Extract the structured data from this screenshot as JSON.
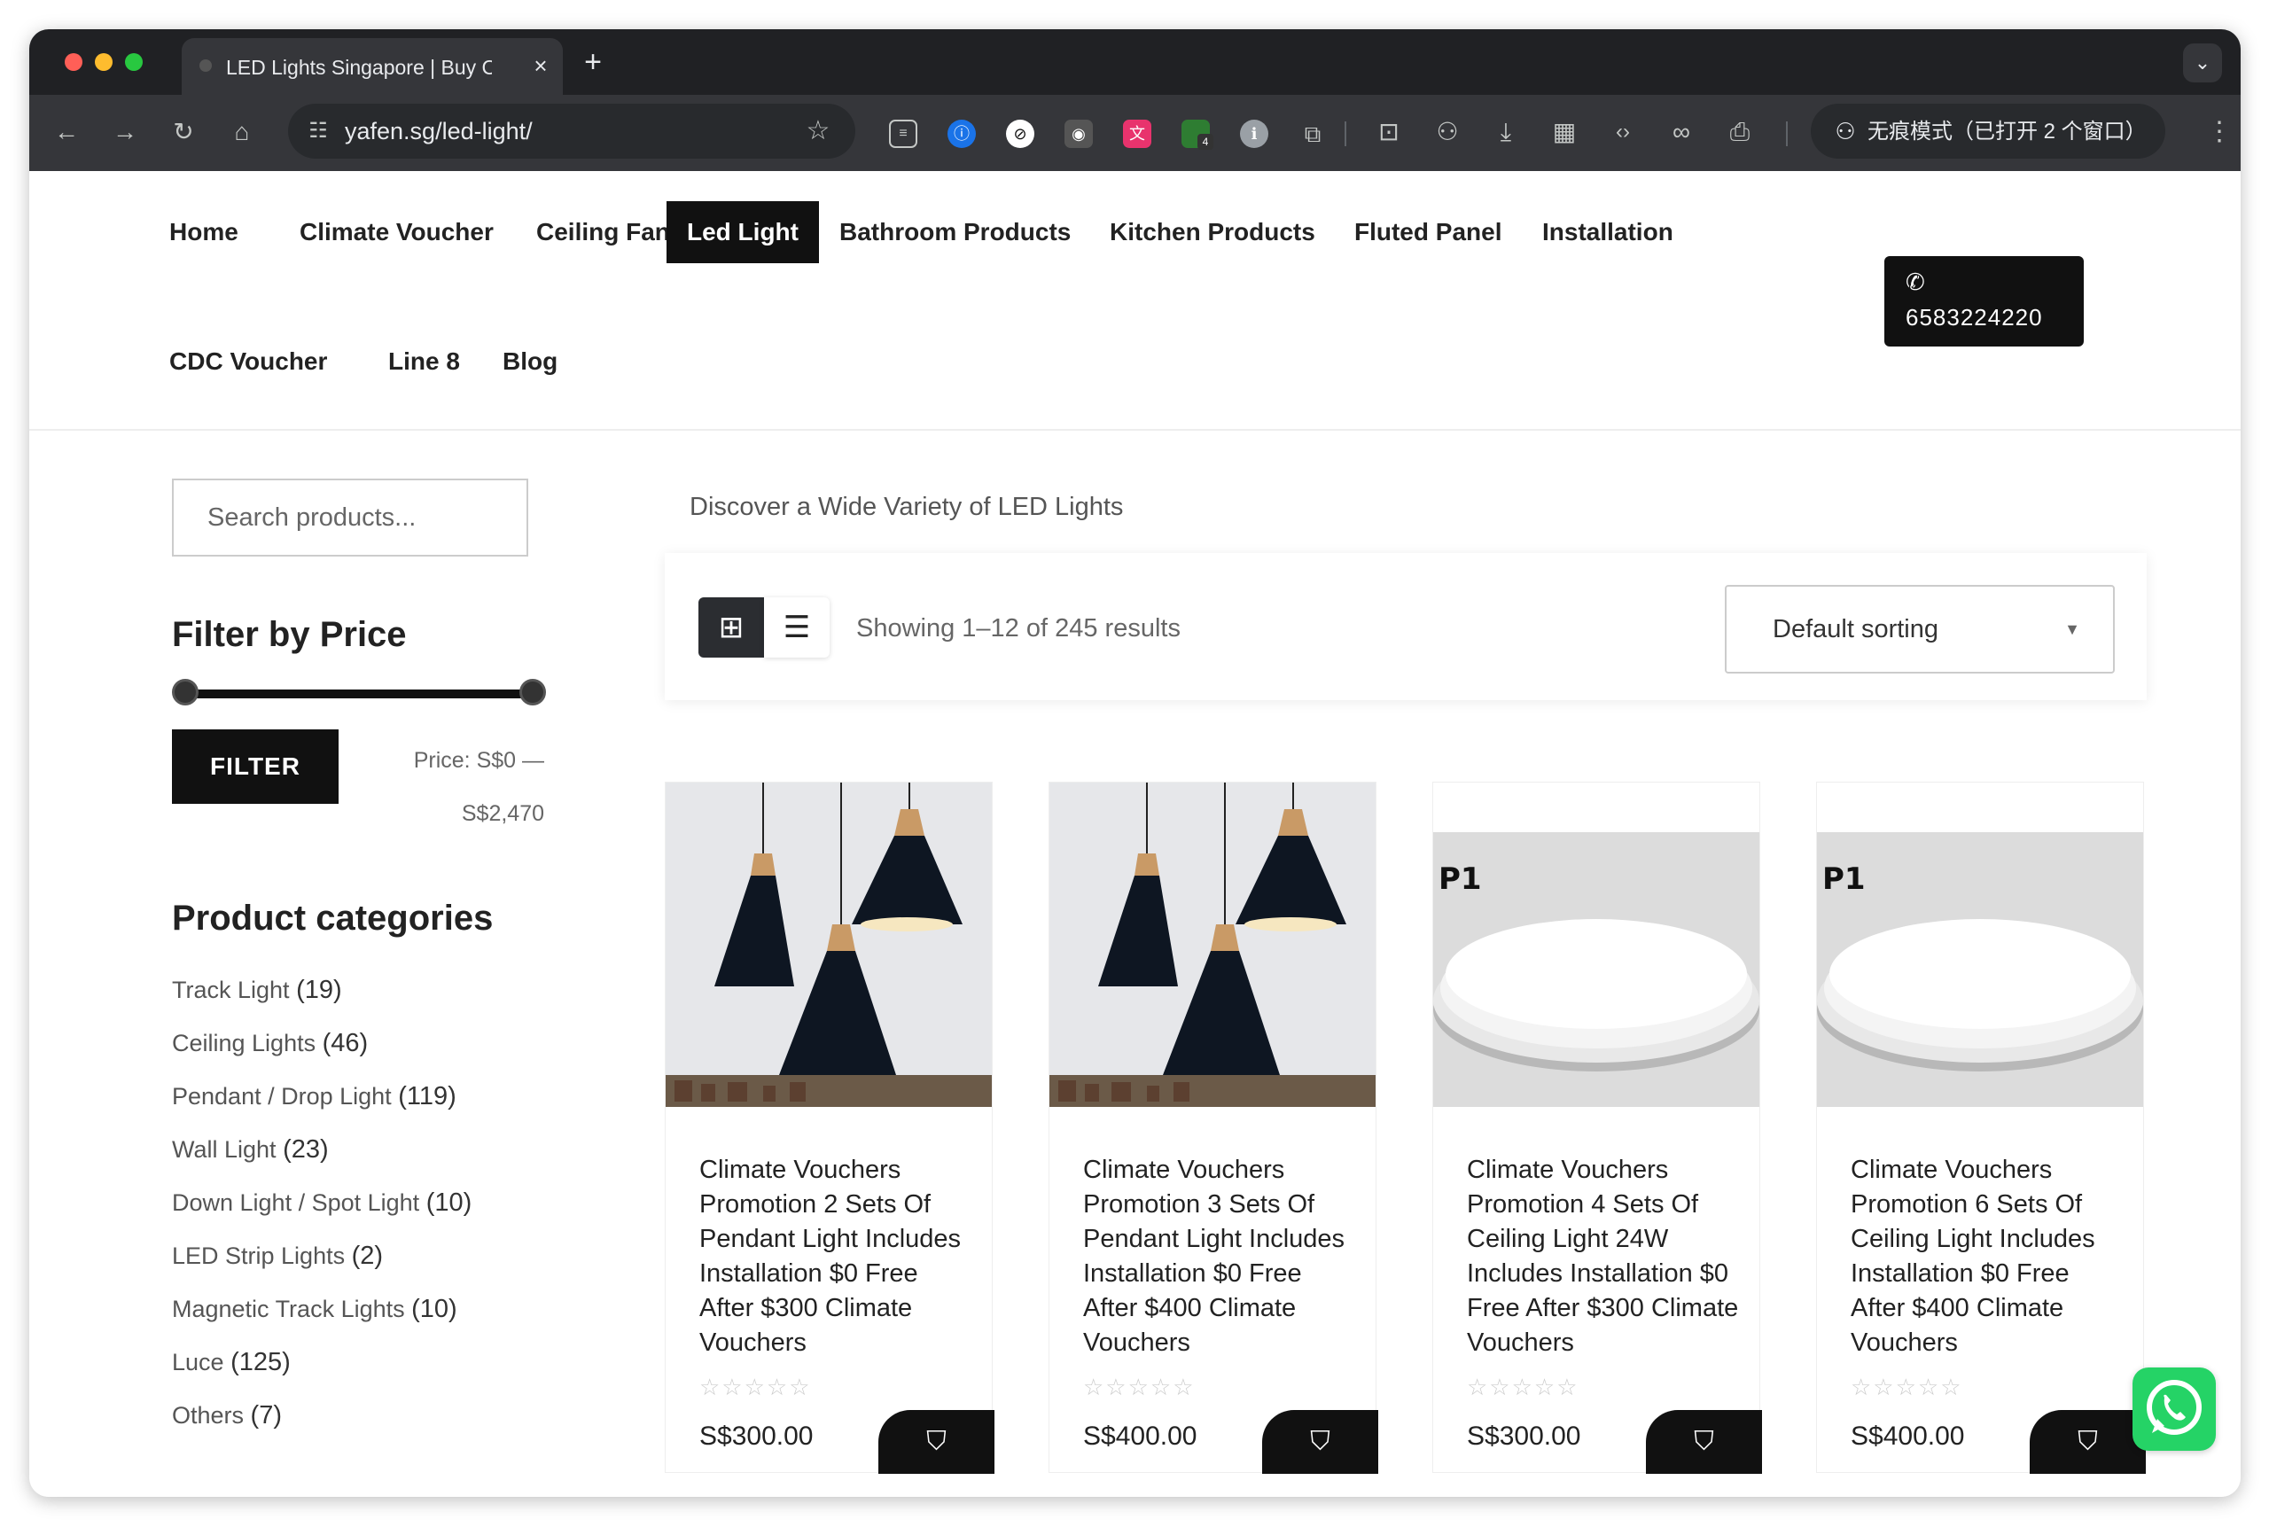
{
  "browser": {
    "tab_title": "LED Lights Singapore | Buy C",
    "url": "yafen.sg/led-light/",
    "incognito_label": "无痕模式（已打开 2 个窗口）",
    "ext_badge": "4"
  },
  "nav": {
    "items": [
      "Home",
      "Climate Voucher",
      "Ceiling Fan",
      "Led Light",
      "Bathroom Products",
      "Kitchen Products",
      "Fluted Panel",
      "Installation",
      "CDC Voucher",
      "Line 8",
      "Blog"
    ],
    "active": "Led Light",
    "phone": "6583224220"
  },
  "sidebar": {
    "search_placeholder": "Search products...",
    "filter_title": "Filter by Price",
    "filter_button": "FILTER",
    "price_label": "Price: S$0 —",
    "price_max": "S$2,470",
    "categories_title": "Product categories",
    "categories": [
      {
        "name": "Track Light",
        "count": "(19)"
      },
      {
        "name": "Ceiling Lights",
        "count": "(46)"
      },
      {
        "name": "Pendant / Drop Light",
        "count": "(119)"
      },
      {
        "name": "Wall Light",
        "count": "(23)"
      },
      {
        "name": "Down Light / Spot Light",
        "count": "(10)"
      },
      {
        "name": "LED Strip Lights",
        "count": "(2)"
      },
      {
        "name": "Magnetic Track Lights",
        "count": "(10)"
      },
      {
        "name": "Luce",
        "count": "(125)"
      },
      {
        "name": "Others",
        "count": "(7)"
      }
    ]
  },
  "main": {
    "subheading": "Discover a Wide Variety of LED Lights",
    "showing": "Showing 1–12 of 245 results",
    "sort": "Default sorting"
  },
  "products": [
    {
      "name": "Climate Vouchers Promotion 2 Sets Of Pendant Light Includes Installation $0 Free After $300 Climate Vouchers",
      "price": "S$300.00",
      "rating": 0
    },
    {
      "name": "Climate Vouchers Promotion 3 Sets Of Pendant Light Includes Installation $0 Free After $400 Climate Vouchers",
      "price": "S$400.00",
      "rating": 0
    },
    {
      "name": "Climate Vouchers Promotion 4 Sets Of Ceiling Light 24W Includes Installation $0 Free After $300 Climate Vouchers",
      "price": "S$300.00",
      "rating": 0
    },
    {
      "name": "Climate Vouchers Promotion 6 Sets Of Ceiling Light Includes Installation $0 Free After $400 Climate Vouchers",
      "price": "S$400.00",
      "rating": 0
    }
  ],
  "image_labels": [
    "P1",
    "P1"
  ]
}
